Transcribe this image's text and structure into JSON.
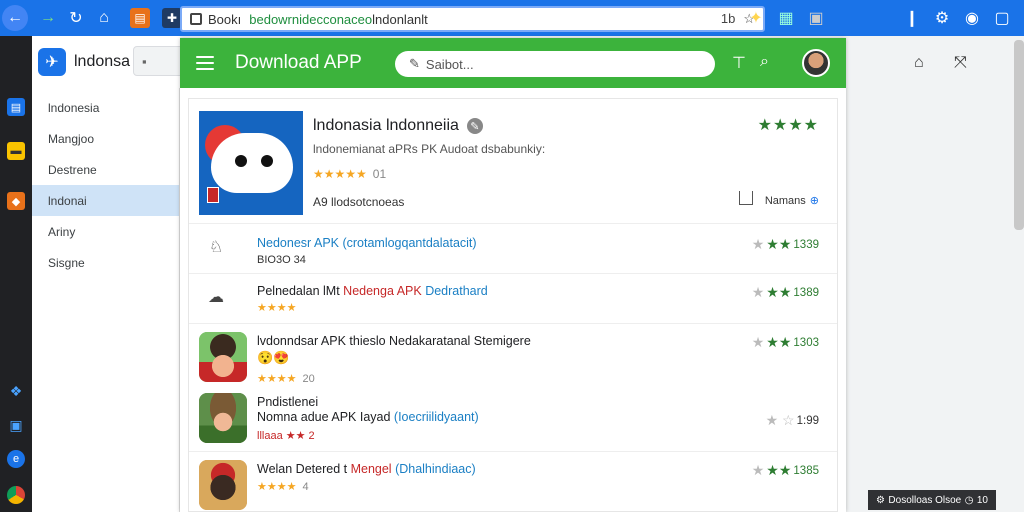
{
  "browser": {
    "url_left": "Bookı",
    "url_green": "bedowrnidecconaceo",
    "url_rest": " lndonlanlt",
    "addr_right": "1b",
    "star": "☆"
  },
  "sidebar": {
    "title": "lndonsa",
    "items": [
      {
        "label": "lndonesia",
        "active": false
      },
      {
        "label": "Mangjoo",
        "active": false
      },
      {
        "label": "Destrene",
        "active": false
      },
      {
        "label": "lndonai",
        "active": true
      },
      {
        "label": "Ariny",
        "active": false
      },
      {
        "label": "Sisgne",
        "active": false
      }
    ]
  },
  "app": {
    "title": "Download APP",
    "search_placeholder": "Saibot...",
    "hero": {
      "title": "lndonasia lndonneiia",
      "description": "lndonemianat aPRs PK  Audoat dsbabunkiy:",
      "rating_stars": "★★★★★",
      "rating_num": "01",
      "developer": "A9  llodsotcnoeas",
      "top_stars": "★★★★",
      "names_label": "Namans"
    },
    "rows": [
      {
        "title_prefix": "",
        "title_blue": "Nedonesr APK (crotamlogqantdalatacit)",
        "title_red": "",
        "title_suffix": "",
        "sub": "BIO3O 34",
        "stars": "",
        "stars_num": "",
        "score": "1339",
        "icon": "bell-icon"
      },
      {
        "title_prefix": "Pelnedalan lMt ",
        "title_blue": "",
        "title_red": "Nedenga APK ",
        "title_suffix": "Dedrathard",
        "sub": "",
        "stars": "★★★★",
        "stars_num": "",
        "score": "1389",
        "icon": "cloud-icon"
      },
      {
        "title_prefix": "lvdonndsar APK thieslo  Nedakaratanal Stemigere",
        "title_blue": "",
        "title_red": "",
        "title_suffix": "",
        "sub": "😯😍",
        "stars": "★★★★",
        "stars_num": "20",
        "score": "1303",
        "icon": "character-icon"
      },
      {
        "title_prefix": "Pndistlenei",
        "title_line2": "Nomna adue APK  Iayad ",
        "title_blue": "(Ioecriilidyaant)",
        "title_red": "",
        "title_suffix": "",
        "sub": "lllaaa ★★  2",
        "stars": "",
        "stars_num": "",
        "score": "1:99",
        "icon": "explorer-icon"
      },
      {
        "title_prefix": "Welan Detered t ",
        "title_blue": "",
        "title_red": "Mengel ",
        "title_suffix": "(Dhalhindiaac)",
        "sub": "",
        "stars": "★★★★",
        "stars_num": "4",
        "score": "1385",
        "icon": "ninja-icon"
      }
    ]
  },
  "toast": {
    "label": "Dosolloas Olsoe",
    "value": "10"
  }
}
